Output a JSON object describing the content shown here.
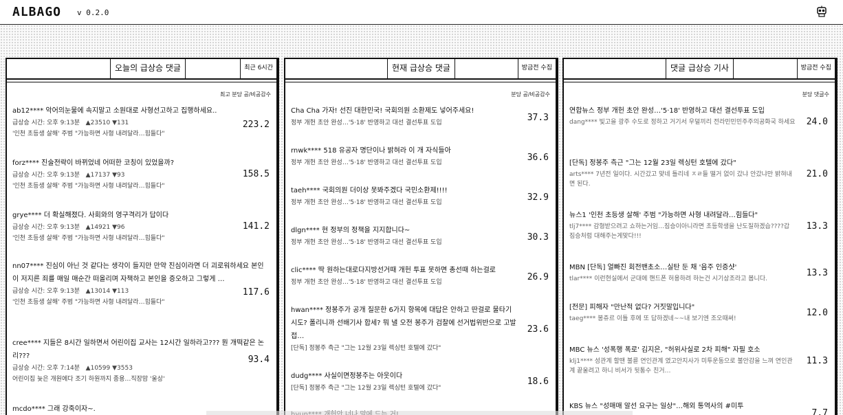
{
  "app": {
    "logo": "ALBAGO",
    "version": "v 0.2.0",
    "icon": "robot-icon"
  },
  "panels": [
    {
      "title": "오늘의 급상승 댓글",
      "subtitle": "최근 6시간",
      "column_header": "최고 분당 공/비공감수",
      "items": [
        {
          "title": "ab12**** 악어의눈물에 속지말고 소원대로 사형선고하고 집행하세요..",
          "time_label": "급상승 시간: 오후 9:13분",
          "up": "▲23510",
          "down": "▼131",
          "article": "'인천 초등생 살해' 주범 \"가능하면 사형 내려달라…힘들다\"",
          "score": "223.2"
        },
        {
          "title": "forz**** 진술전략이 바뀌었네 어떠한 코칭이 있었을까?",
          "time_label": "급상승 시간: 오후 9:13분",
          "up": "▲17137",
          "down": "▼93",
          "article": "'인천 초등생 살해' 주범 \"가능하면 사형 내려달라…힘들다\"",
          "score": "158.5"
        },
        {
          "title": "grye**** 더 확실해졌다. 사회와의 영구격리가 답이다",
          "time_label": "급상승 시간: 오후 9:13분",
          "up": "▲14921",
          "down": "▼96",
          "article": "'인천 초등생 살해' 주범 \"가능하면 사형 내려달라…힘들다\"",
          "score": "141.2"
        },
        {
          "title": "nn07**** 진심이 아닌 것 같다는 생각이 들지만 만약 진심이라면 더 괴로워하세요 본인이 저지른 죄를 매일 매순간 떠올리며 자책하고 본인을 증오하고 그렇게 …",
          "time_label": "급상승 시간: 오후 9:13분",
          "up": "▲13014",
          "down": "▼113",
          "article": "'인천 초등생 살해' 주범 \"가능하면 사형 내려달라…힘들다\"",
          "score": "117.6"
        },
        {
          "title": "cree**** 지들은 8시간 일하면서 어린이집 교사는 12시간 일하라고??? 뭔 개떡같은 논리???",
          "time_label": "급상승 시간: 오후 7:14분",
          "up": "▲10599",
          "down": "▼3553",
          "article": "어린이집 늦은 개원에다 조기 하원까지 종용…직장맘 '울상'",
          "score": "93.4"
        },
        {
          "title": "mcdo**** 그래 강죽이자~.",
          "time_label": "",
          "up": "",
          "down": "",
          "article": "",
          "score": ""
        }
      ]
    },
    {
      "title": "현재 급상승 댓글",
      "subtitle": "방금전 수집",
      "column_header": "분당 공/비공감수",
      "items": [
        {
          "title": "Cha Cha 가자! 선진 대한민국! 국회의원 소환제도 넣어주세요!",
          "article": "정부 개헌 초안 완성…'5·18' 반영하고 대선 결선투표 도입",
          "score": "37.3"
        },
        {
          "title": "rnwk**** 518 유공자 명단이나 밝혀라 이 개 자식들아",
          "article": "정부 개헌 초안 완성…'5·18' 반영하고 대선 결선투표 도입",
          "score": "36.6"
        },
        {
          "title": "taeh**** 국회의원 더이상 못봐주겠다 국민소환제!!!!",
          "article": "정부 개헌 초안 완성…'5·18' 반영하고 대선 결선투표 도입",
          "score": "32.9"
        },
        {
          "title": "dlgn**** 현 정부의 정책을 지지합니다~",
          "article": "정부 개헌 초안 완성…'5·18' 반영하고 대선 결선투표 도입",
          "score": "30.3"
        },
        {
          "title": "clic**** 딱 원하는대로다지방선거때 개헌 투표 못하면 총선때 하는걸로",
          "article": "정부 개헌 초안 완성…'5·18' 반영하고 대선 결선투표 도입",
          "score": "26.9"
        },
        {
          "title": "hwan**** 정봉주가 공개 질문한 6가지 항목에 대답은 안하고 딴걸로 물타기 시도? 폴리니까 선배기사 합세? 뭐 낼 오전 봉주가 검찰에 선거법위반으로 고발접…",
          "article": "[단독] 정봉주 측근 \"그는 12월 23일 렉싱턴 호텔에 갔다\"",
          "score": "23.6"
        },
        {
          "title": "dudg**** 사실이면정봉주는 아웃이다",
          "article": "[단독] 정봉주 측근 \"그는 12월 23일 렉싱턴 호텔에 갔다\"",
          "score": "18.6"
        },
        {
          "title": "hyun**** 개헌안 너나 맘에 드는 거!",
          "article": "",
          "score": ""
        }
      ]
    },
    {
      "title": "댓글 급상승 기사",
      "subtitle": "방금전 수집",
      "column_header": "분당 댓글수",
      "items": [
        {
          "title": "연합뉴스 정부 개헌 초안 완성…'5·18' 반영하고 대선 결선투표 도입",
          "comment": "dang**** 빛고을 광주 수도로 정하고 거기서 우덜끼리 전라민민민주주의공화국 하세요",
          "score": "24.0"
        },
        {
          "title": "[단독] 정봉주 측근 \"그는 12월 23일 렉싱턴 호텔에 갔다\"",
          "comment": "arts**** 7년전 일이다. 시간갔고 맞네 틀리네 ㅈㄹ들 떨거 없이 갔냐 안갔냐만 밝혀내면 된다.",
          "score": "21.0"
        },
        {
          "title": "뉴스1 '인천 초등생 살해' 주범 \"가능하면 사형 내려달라…힘들다\"",
          "comment": "tlj7**** 감형받으려고 쇼하는거임…짐승이아니라면 초등학생을 난도질하겠습????갑 짐승처럼 대해주는게맞다!!!",
          "score": "13.3"
        },
        {
          "title": "MBN [단독] 얼빠진 회전밴초소…실탄 둔 채 '음주 인증샷'",
          "comment": "tlar**** 이런현실에서 군대에 핸드폰 허용하려 하는건 시기상조라고 봅니다.",
          "score": "13.3"
        },
        {
          "title": "[전문] 피해자 \"만난적 없다? 거짓말입니다\"",
          "comment": "taeg**** 봉쥬르 이틀 후에 또 답하겠네~~내 보기엔 조오때써!",
          "score": "12.0"
        },
        {
          "title": "MBC 뉴스 '성폭행 폭로' 김지은, \"허위사실로 2차 피해\" 자필 호소",
          "comment": "klj1**** 성관계 할땐 불륜 연인관계 였고안지사가 미투운동으로 불안감을 느껴 연인관계 끝울려고 하니 비서가 뒷통수 친거…",
          "score": "11.3"
        },
        {
          "title": "KBS 뉴스 \"성매매 알선 요구는 일상\"…해외 통역사의 #미투",
          "comment": "",
          "score": "7.7"
        }
      ]
    }
  ]
}
